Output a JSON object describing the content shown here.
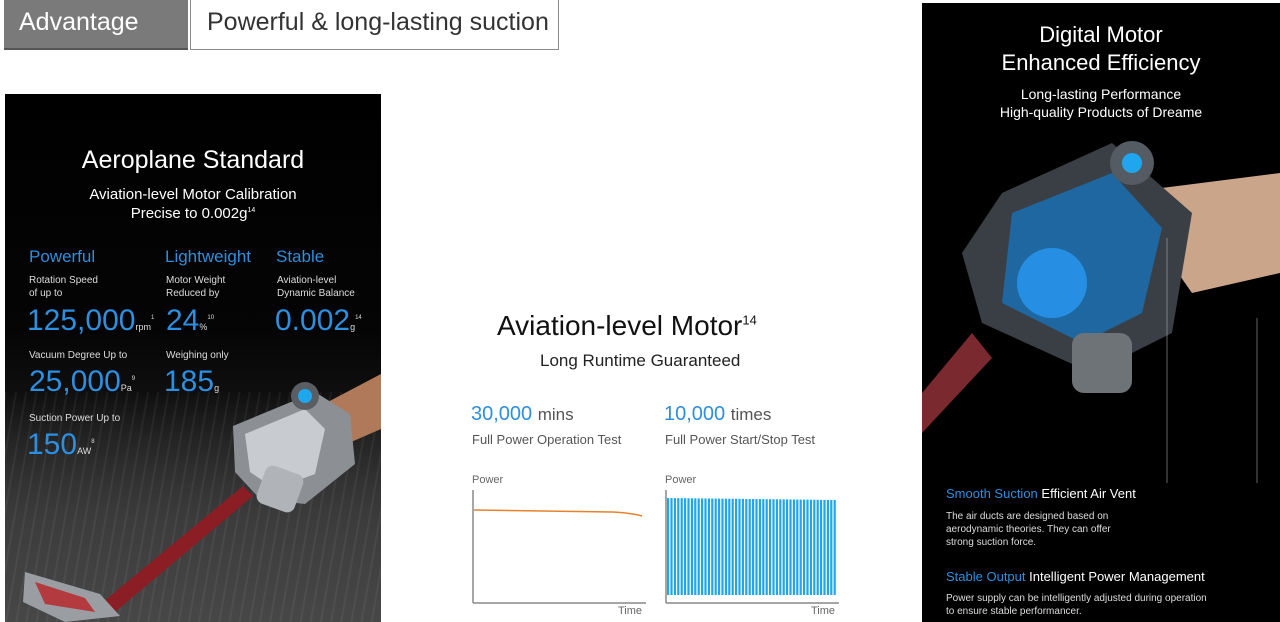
{
  "tabs": {
    "advantage": "Advantage",
    "title": "Powerful & long-lasting suction"
  },
  "left_panel": {
    "title": "Aeroplane Standard",
    "subtitle_line1": "Aviation-level Motor Calibration",
    "subtitle_line2": "Precise to 0.002g",
    "subtitle_sup": "14",
    "features": [
      {
        "label": "Powerful",
        "desc1": "Rotation Speed",
        "desc2": "of up to",
        "value": "125,000",
        "unit": "rpm",
        "sup": "1"
      },
      {
        "label": "Lightweight",
        "desc1": "Motor Weight",
        "desc2": "Reduced by",
        "value": "24",
        "unit": "%",
        "sup": "10"
      },
      {
        "label": "Stable",
        "desc1": "Aviation-level",
        "desc2": "Dynamic Balance",
        "value": "0.002",
        "unit": "g",
        "sup": "14"
      }
    ],
    "vacuum": {
      "desc": "Vacuum Degree Up to",
      "value": "25,000",
      "unit": "Pa",
      "sup": "9"
    },
    "weight": {
      "desc": "Weighing only",
      "value": "185",
      "unit": "g"
    },
    "suction": {
      "desc": "Suction Power Up to",
      "value": "150",
      "unit": "AW",
      "sup": "8"
    }
  },
  "middle": {
    "title": "Aviation-level Motor",
    "title_sup": "14",
    "subtitle": "Long Runtime Guaranteed",
    "stat1": {
      "value": "30,000",
      "unit": "mins",
      "desc": "Full Power Operation Test"
    },
    "stat2": {
      "value": "10,000",
      "unit": "times",
      "desc": "Full Power Start/Stop Test"
    },
    "chart_y_label": "Power",
    "chart_x_label": "Time"
  },
  "right_panel": {
    "title1": "Digital Motor",
    "title2": "Enhanced Efficiency",
    "tag1": "Long-lasting Performance",
    "tag2": "High-quality Products of Dreame",
    "section1": {
      "title_blue": "Smooth Suction",
      "title_white": "Efficient Air Vent",
      "body1": "The air ducts are designed based on",
      "body2": "aerodynamic theories. They can offer",
      "body3": "strong suction force."
    },
    "section2": {
      "title_blue": "Stable Output",
      "title_white": "Intelligent Power Management",
      "body1": "Power supply can be intelligently adjusted during operation",
      "body2": "to ensure stable performancer."
    }
  },
  "colors": {
    "accent_blue": "#2d8fe0",
    "chart_orange": "#e8822a",
    "chart_cyan": "#1fa6ee"
  }
}
